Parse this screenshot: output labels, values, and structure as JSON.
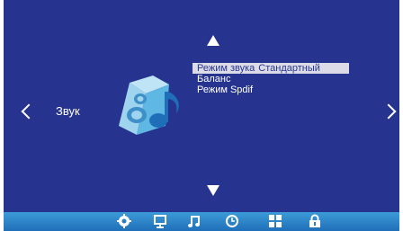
{
  "category": {
    "label": "Звук"
  },
  "menu": {
    "items": [
      {
        "label": "Режим звука",
        "value": "Стандартный",
        "selected": true
      },
      {
        "label": "Баланс",
        "value": "",
        "selected": false
      },
      {
        "label": "Режим Spdif",
        "value": "",
        "selected": false
      }
    ]
  },
  "bottom_bar": {
    "icons": [
      "settings-icon",
      "display-icon",
      "music-icon",
      "clock-icon",
      "grid-icon",
      "lock-icon"
    ]
  },
  "colors": {
    "background": "#27348f",
    "bar": "#3d9bd8",
    "highlight": "#dcdce8"
  }
}
